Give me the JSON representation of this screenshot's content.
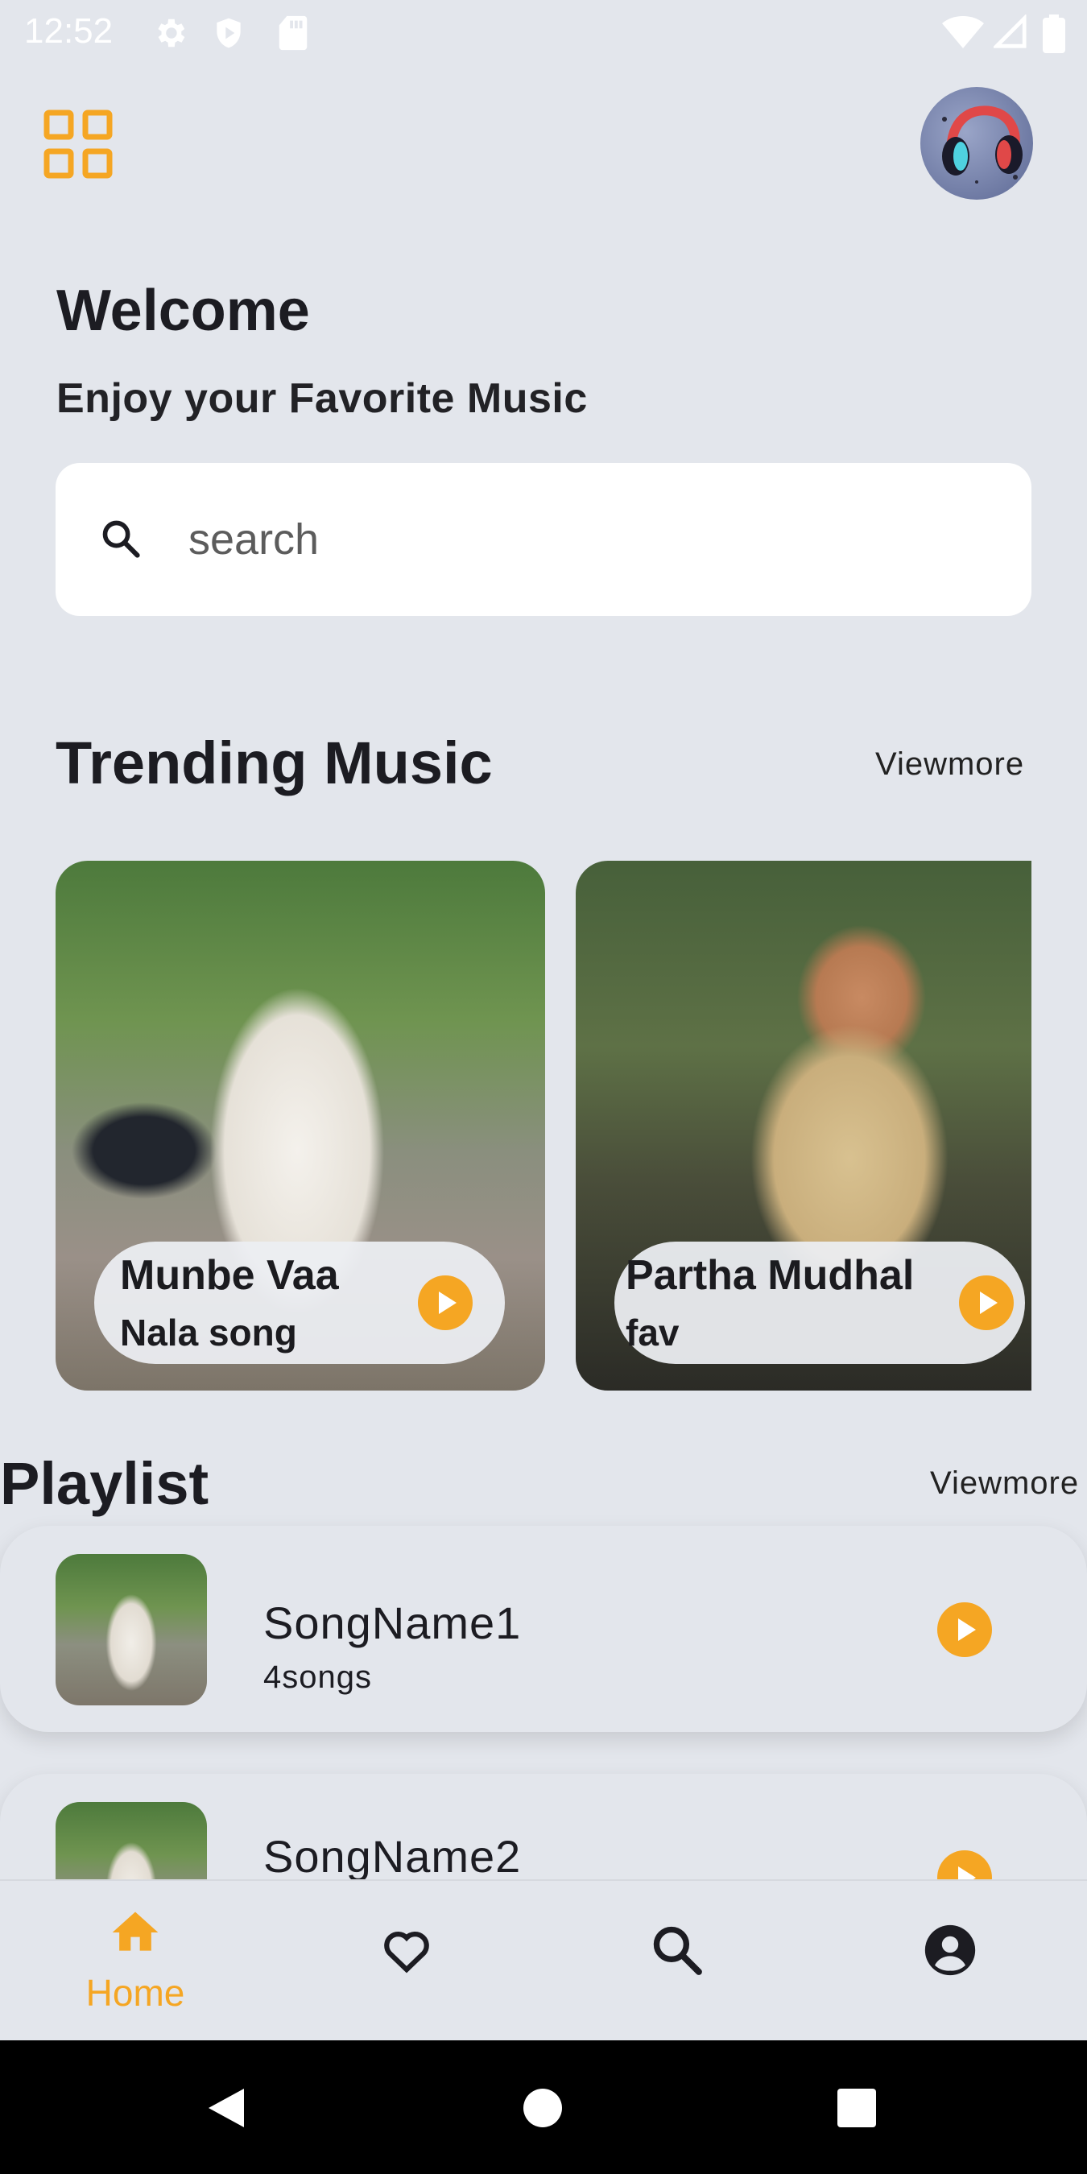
{
  "status_bar": {
    "time": "12:52"
  },
  "header": {
    "menu_icon": "grid-icon",
    "avatar_icon": "headphones-avatar"
  },
  "welcome": {
    "title": "Welcome",
    "subtitle": "Enjoy your Favorite Music"
  },
  "search": {
    "placeholder": "search"
  },
  "trending": {
    "title": "Trending Music",
    "viewmore": "Viewmore",
    "cards": [
      {
        "title": "Munbe Vaa",
        "subtitle": "Nala song"
      },
      {
        "title": "Partha Mudhal",
        "subtitle": "fav"
      }
    ]
  },
  "playlist": {
    "title": "Playlist",
    "viewmore": "Viewmore",
    "items": [
      {
        "name": "SongName1",
        "count": "4songs"
      },
      {
        "name": "SongName2",
        "count": ""
      }
    ]
  },
  "bottom_nav": {
    "items": [
      {
        "label": "Home",
        "icon": "home-icon",
        "active": true
      },
      {
        "label": "",
        "icon": "heart-icon",
        "active": false
      },
      {
        "label": "",
        "icon": "search-icon",
        "active": false
      },
      {
        "label": "",
        "icon": "account-icon",
        "active": false
      }
    ]
  },
  "colors": {
    "accent": "#f5a623",
    "background": "#e3e6ec",
    "text": "#1c1c22"
  }
}
